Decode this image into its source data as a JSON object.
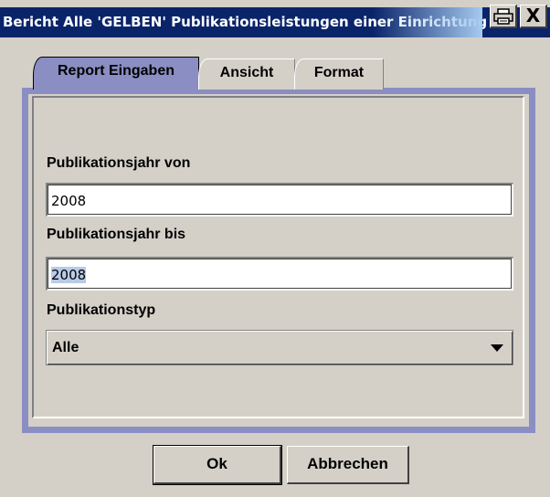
{
  "window": {
    "title": "Bericht Alle 'GELBEN' Publikationsleistungen einer Einrichtung",
    "print_icon": "print-icon",
    "close_label": "X"
  },
  "tabs": [
    {
      "label": "Report Eingaben",
      "active": true
    },
    {
      "label": "Ansicht",
      "active": false
    },
    {
      "label": "Format",
      "active": false
    }
  ],
  "form": {
    "year_from_label": "Publikationsjahr von",
    "year_from_value": "2008",
    "year_to_label": "Publikationsjahr bis",
    "year_to_value": "2008",
    "type_label": "Publikationstyp",
    "type_value": "Alle"
  },
  "buttons": {
    "ok": "Ok",
    "cancel": "Abbrechen"
  },
  "colors": {
    "titlebar": "#0a246a",
    "tab_active": "#8a8ec2",
    "window_bg": "#d4d0c8",
    "selection": "#b8cbe8"
  }
}
